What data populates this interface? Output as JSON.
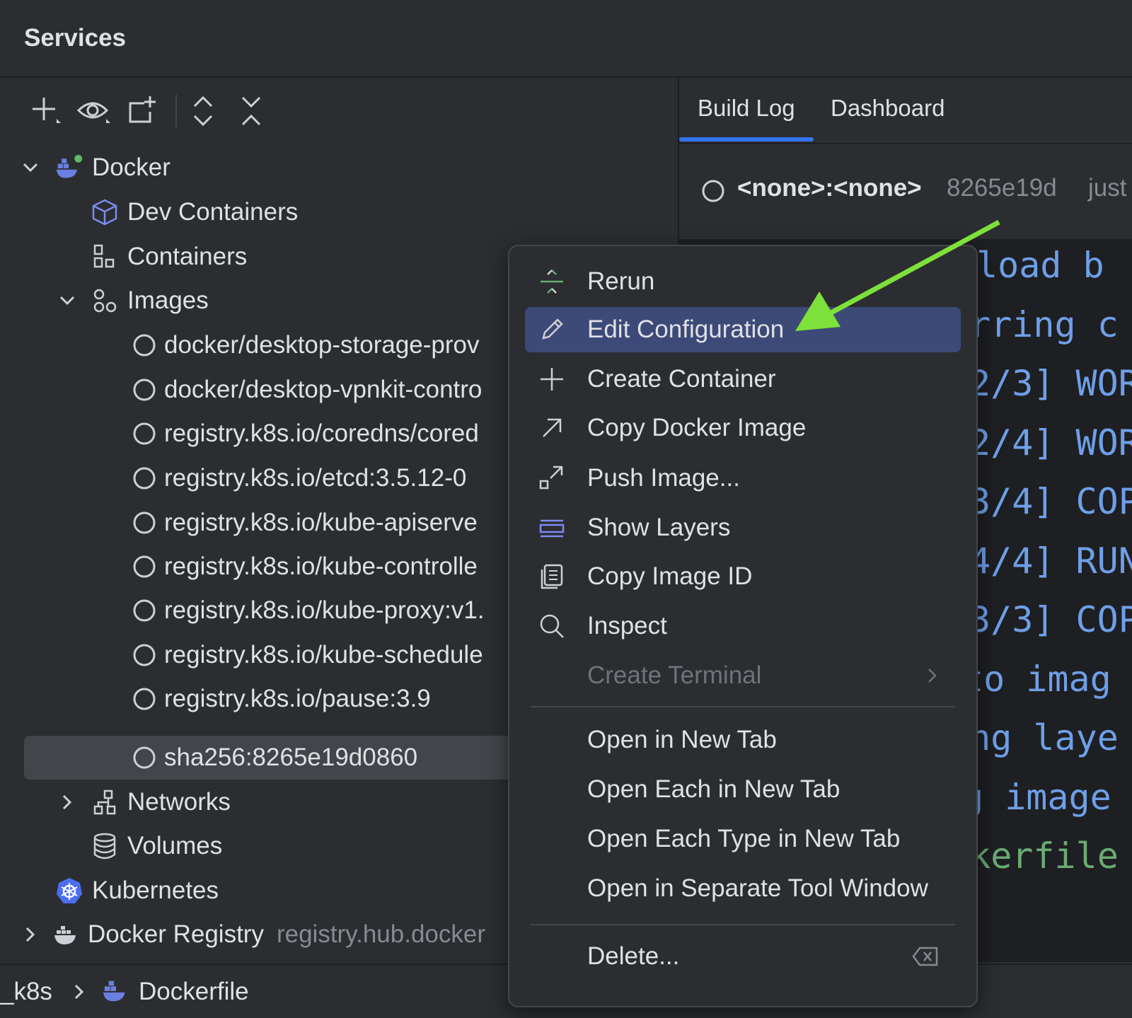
{
  "header": {
    "title": "Services"
  },
  "toolbar": {
    "buttons": [
      {
        "icon": "add-icon"
      },
      {
        "icon": "eye-icon"
      },
      {
        "icon": "new-tab-icon"
      },
      {
        "icon": "expand-all-icon"
      },
      {
        "icon": "collapse-all-icon"
      }
    ]
  },
  "tree": {
    "docker": "Docker",
    "dev_containers": "Dev Containers",
    "containers": "Containers",
    "images": "Images",
    "image_items": [
      "docker/desktop-storage-prov",
      "docker/desktop-vpnkit-contro",
      "registry.k8s.io/coredns/cored",
      "registry.k8s.io/etcd:3.5.12-0",
      "registry.k8s.io/kube-apiserve",
      "registry.k8s.io/kube-controlle",
      "registry.k8s.io/kube-proxy:v1.",
      "registry.k8s.io/kube-schedule",
      "registry.k8s.io/pause:3.9",
      "sha256:8265e19d0860"
    ],
    "networks": "Networks",
    "volumes": "Volumes",
    "kubernetes": "Kubernetes",
    "docker_registry": "Docker Registry",
    "docker_registry_sub": "registry.hub.docker"
  },
  "right": {
    "tabs": [
      "Build Log",
      "Dashboard"
    ],
    "image_name": "<none>:<none>",
    "image_id": "8265e19d",
    "image_time": "just",
    "log_lines": [
      {
        "text": "load b",
        "color": "#6e9fe8"
      },
      {
        "text": "erring c",
        "color": "#6e9fe8"
      },
      {
        "text": "2/3] WOR",
        "color": "#6e9fe8"
      },
      {
        "text": "2/4] WOR",
        "color": "#6e9fe8"
      },
      {
        "text": "3/4] COP",
        "color": "#6e9fe8"
      },
      {
        "text": "4/4] RUN",
        "color": "#6e9fe8"
      },
      {
        "text": "3/3] COP",
        "color": "#6e9fe8"
      },
      {
        "text": "to imag",
        "color": "#6e9fe8"
      },
      {
        "text": "ing laye",
        "color": "#6e9fe8"
      },
      {
        "text": "g image",
        "color": "#6e9fe8"
      },
      {
        "text": "ckerfile",
        "color": "#6aab73"
      }
    ]
  },
  "status": {
    "crumb_project": "_k8s",
    "crumb_file": "Dockerfile"
  },
  "menu": {
    "items": [
      {
        "label": "Rerun",
        "icon": "rerun-icon"
      },
      {
        "label": "Edit Configuration",
        "icon": "pencil-icon"
      },
      {
        "label": "Create Container",
        "icon": "plus-icon"
      },
      {
        "label": "Copy Docker Image",
        "icon": "arrow-up-right-icon"
      },
      {
        "label": "Push Image...",
        "icon": "push-icon"
      },
      {
        "label": "Show Layers",
        "icon": "layers-icon"
      },
      {
        "label": "Copy Image ID",
        "icon": "copy-icon"
      },
      {
        "label": "Inspect",
        "icon": "search-icon"
      },
      {
        "label": "Create Terminal",
        "icon": "none"
      }
    ],
    "tab_items": [
      "Open in New Tab",
      "Open Each in New Tab",
      "Open Each Type in New Tab",
      "Open in Separate Tool Window"
    ],
    "delete": "Delete..."
  },
  "colors": {
    "accent": "#3574f0",
    "selection": "#3d4a78",
    "arrow": "#7ee03a"
  }
}
